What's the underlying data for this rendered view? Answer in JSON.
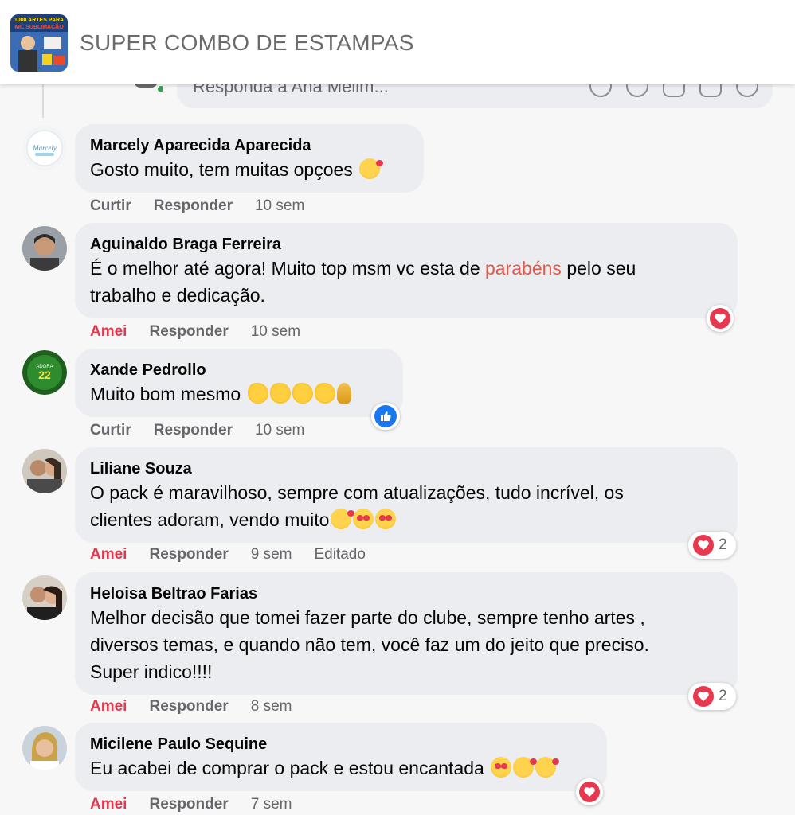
{
  "header": {
    "title": "SUPER COMBO DE ESTAMPAS",
    "logo_text_top": "1000 ARTES PARA",
    "logo_text_mid": "MIL SUBLIMAÇÃO"
  },
  "reply": {
    "placeholder": "Responda a Ana Melim..."
  },
  "comments": [
    {
      "name": "Marcely Aparecida Aparecida",
      "text": "Gosto muito, tem muitas opçoes",
      "emojis": [
        "smiling-face-with-hearts"
      ],
      "action_like": "Curtir",
      "action_reply": "Responder",
      "time": "10 sem"
    },
    {
      "name": "Aguinaldo Braga Ferreira",
      "text_before": "É o melhor até agora! Muito top msm vc esta de ",
      "text_highlight": "parabéns",
      "text_after": " pelo seu",
      "text_line2": "trabalho e dedicação.",
      "action_like": "Amei",
      "action_reply": "Responder",
      "time": "10 sem",
      "reaction": "love"
    },
    {
      "name": "Xande Pedrollo",
      "text": "Muito bom mesmo",
      "emojis": [
        "clapping-hands",
        "clapping-hands",
        "clapping-hands",
        "clapping-hands",
        "folded-hands"
      ],
      "action_like": "Curtir",
      "action_reply": "Responder",
      "time": "10 sem",
      "reaction": "like"
    },
    {
      "name": "Liliane Souza",
      "text_line1": "O pack é maravilhoso, sempre com atualizações, tudo incrível, os",
      "text_line2": "clientes adoram, vendo muito",
      "emojis": [
        "smiling-face-with-hearts",
        "heart-eyes",
        "heart-eyes"
      ],
      "action_like": "Amei",
      "action_reply": "Responder",
      "time": "9 sem",
      "edited": "Editado",
      "reaction": "love",
      "reaction_count": "2"
    },
    {
      "name": "Heloisa Beltrao Farias",
      "text_line1": "Melhor decisão que tomei fazer parte do clube, sempre tenho artes ,",
      "text_line2": "diversos temas, e quando não tem, você faz um do jeito que preciso.",
      "text_line3": "Super indico!!!!",
      "action_like": "Amei",
      "action_reply": "Responder",
      "time": "8 sem",
      "reaction": "love",
      "reaction_count": "2"
    },
    {
      "name": "Micilene Paulo Sequine",
      "text": "Eu acabei de comprar o pack e estou encantada",
      "emojis": [
        "heart-eyes",
        "smiling-face-with-hearts",
        "smiling-face-with-hearts"
      ],
      "action_like": "Amei",
      "action_reply": "Responder",
      "time": "7 sem",
      "reaction": "love"
    }
  ],
  "colors": {
    "bubble": "#ecedf0",
    "love": "#e8384f",
    "like": "#1877f2",
    "highlight": "#e2584a"
  }
}
